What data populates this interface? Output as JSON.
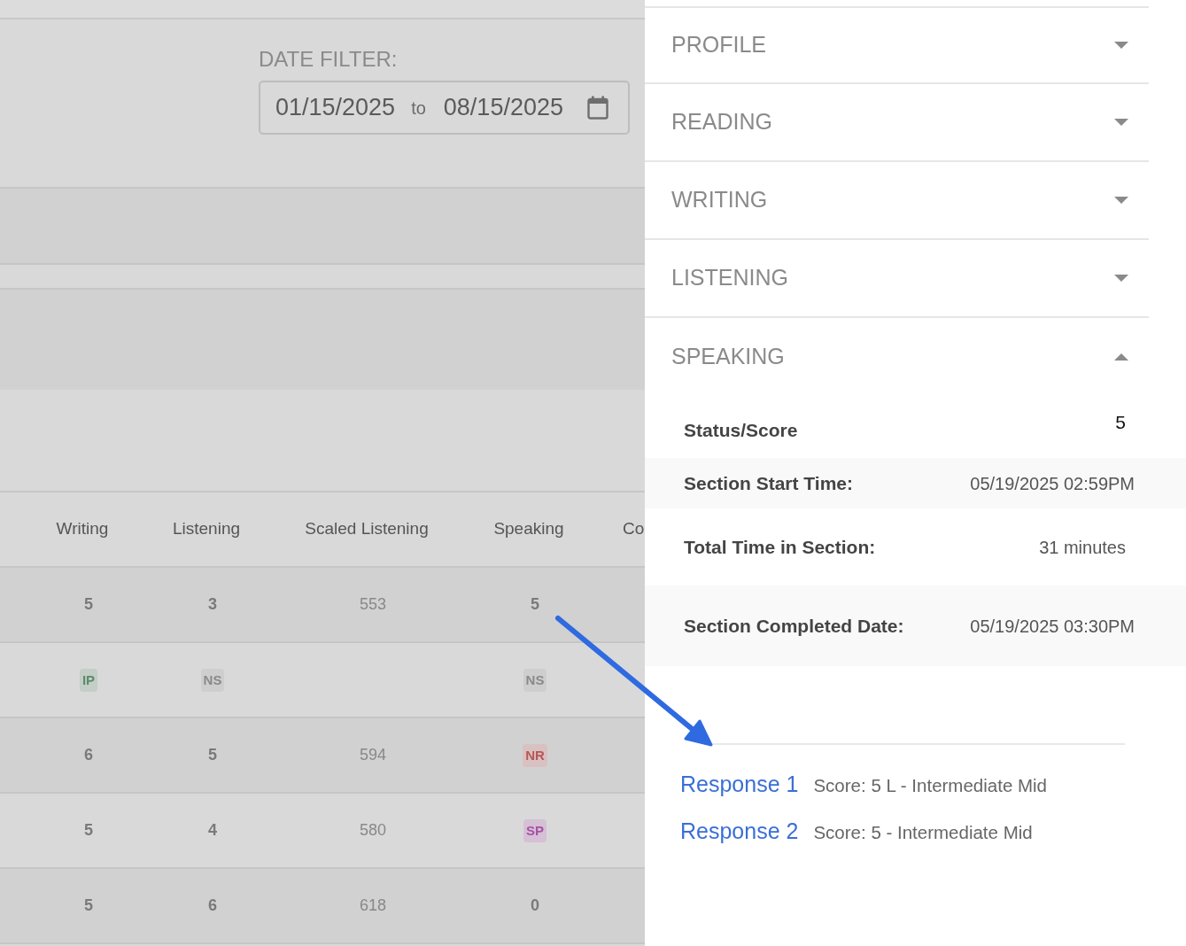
{
  "date_filter": {
    "label": "DATE FILTER:",
    "start": "01/15/2025",
    "separator": "to",
    "end": "08/15/2025"
  },
  "table": {
    "columns": [
      "Writing",
      "Listening",
      "Scaled Listening",
      "Speaking",
      "Co"
    ],
    "rows": [
      {
        "cells": [
          {
            "kind": "score",
            "text": "5"
          },
          {
            "kind": "score",
            "text": "3"
          },
          {
            "kind": "scaled",
            "text": "553"
          },
          {
            "kind": "score",
            "text": "5"
          }
        ]
      },
      {
        "cells": [
          {
            "kind": "badge",
            "text": "IP",
            "color": "#5f8a6d"
          },
          {
            "kind": "badge",
            "text": "NS",
            "color": "#8a8a8a"
          },
          {
            "kind": "blank"
          },
          {
            "kind": "badge",
            "text": "NS",
            "color": "#8a8a8a"
          }
        ]
      },
      {
        "cells": [
          {
            "kind": "score",
            "text": "6"
          },
          {
            "kind": "score",
            "text": "5"
          },
          {
            "kind": "scaled",
            "text": "594"
          },
          {
            "kind": "badge",
            "text": "NR",
            "color": "#b85757"
          }
        ]
      },
      {
        "cells": [
          {
            "kind": "score",
            "text": "5"
          },
          {
            "kind": "score",
            "text": "4"
          },
          {
            "kind": "scaled",
            "text": "580"
          },
          {
            "kind": "badge",
            "text": "SP",
            "color": "#a652a6"
          }
        ]
      },
      {
        "cells": [
          {
            "kind": "score",
            "text": "5"
          },
          {
            "kind": "score",
            "text": "6"
          },
          {
            "kind": "scaled",
            "text": "618"
          },
          {
            "kind": "score",
            "text": "0"
          }
        ]
      }
    ]
  },
  "panel": {
    "sections": [
      {
        "title": "PROFILE",
        "expanded": false
      },
      {
        "title": "READING",
        "expanded": false
      },
      {
        "title": "WRITING",
        "expanded": false
      },
      {
        "title": "LISTENING",
        "expanded": false
      },
      {
        "title": "SPEAKING",
        "expanded": true
      }
    ],
    "details": [
      {
        "label": "Status/Score",
        "value": "5"
      },
      {
        "label": "Section Start Time:",
        "value": "05/19/2025 02:59PM"
      },
      {
        "label": "Total Time in Section:",
        "value": "31 minutes"
      },
      {
        "label": "Section Completed Date:",
        "value": "05/19/2025 03:30PM"
      }
    ],
    "responses": [
      {
        "link": "Response 1",
        "score": "Score: 5 L - Intermediate Mid"
      },
      {
        "link": "Response 2",
        "score": "Score: 5 - Intermediate Mid"
      }
    ]
  }
}
